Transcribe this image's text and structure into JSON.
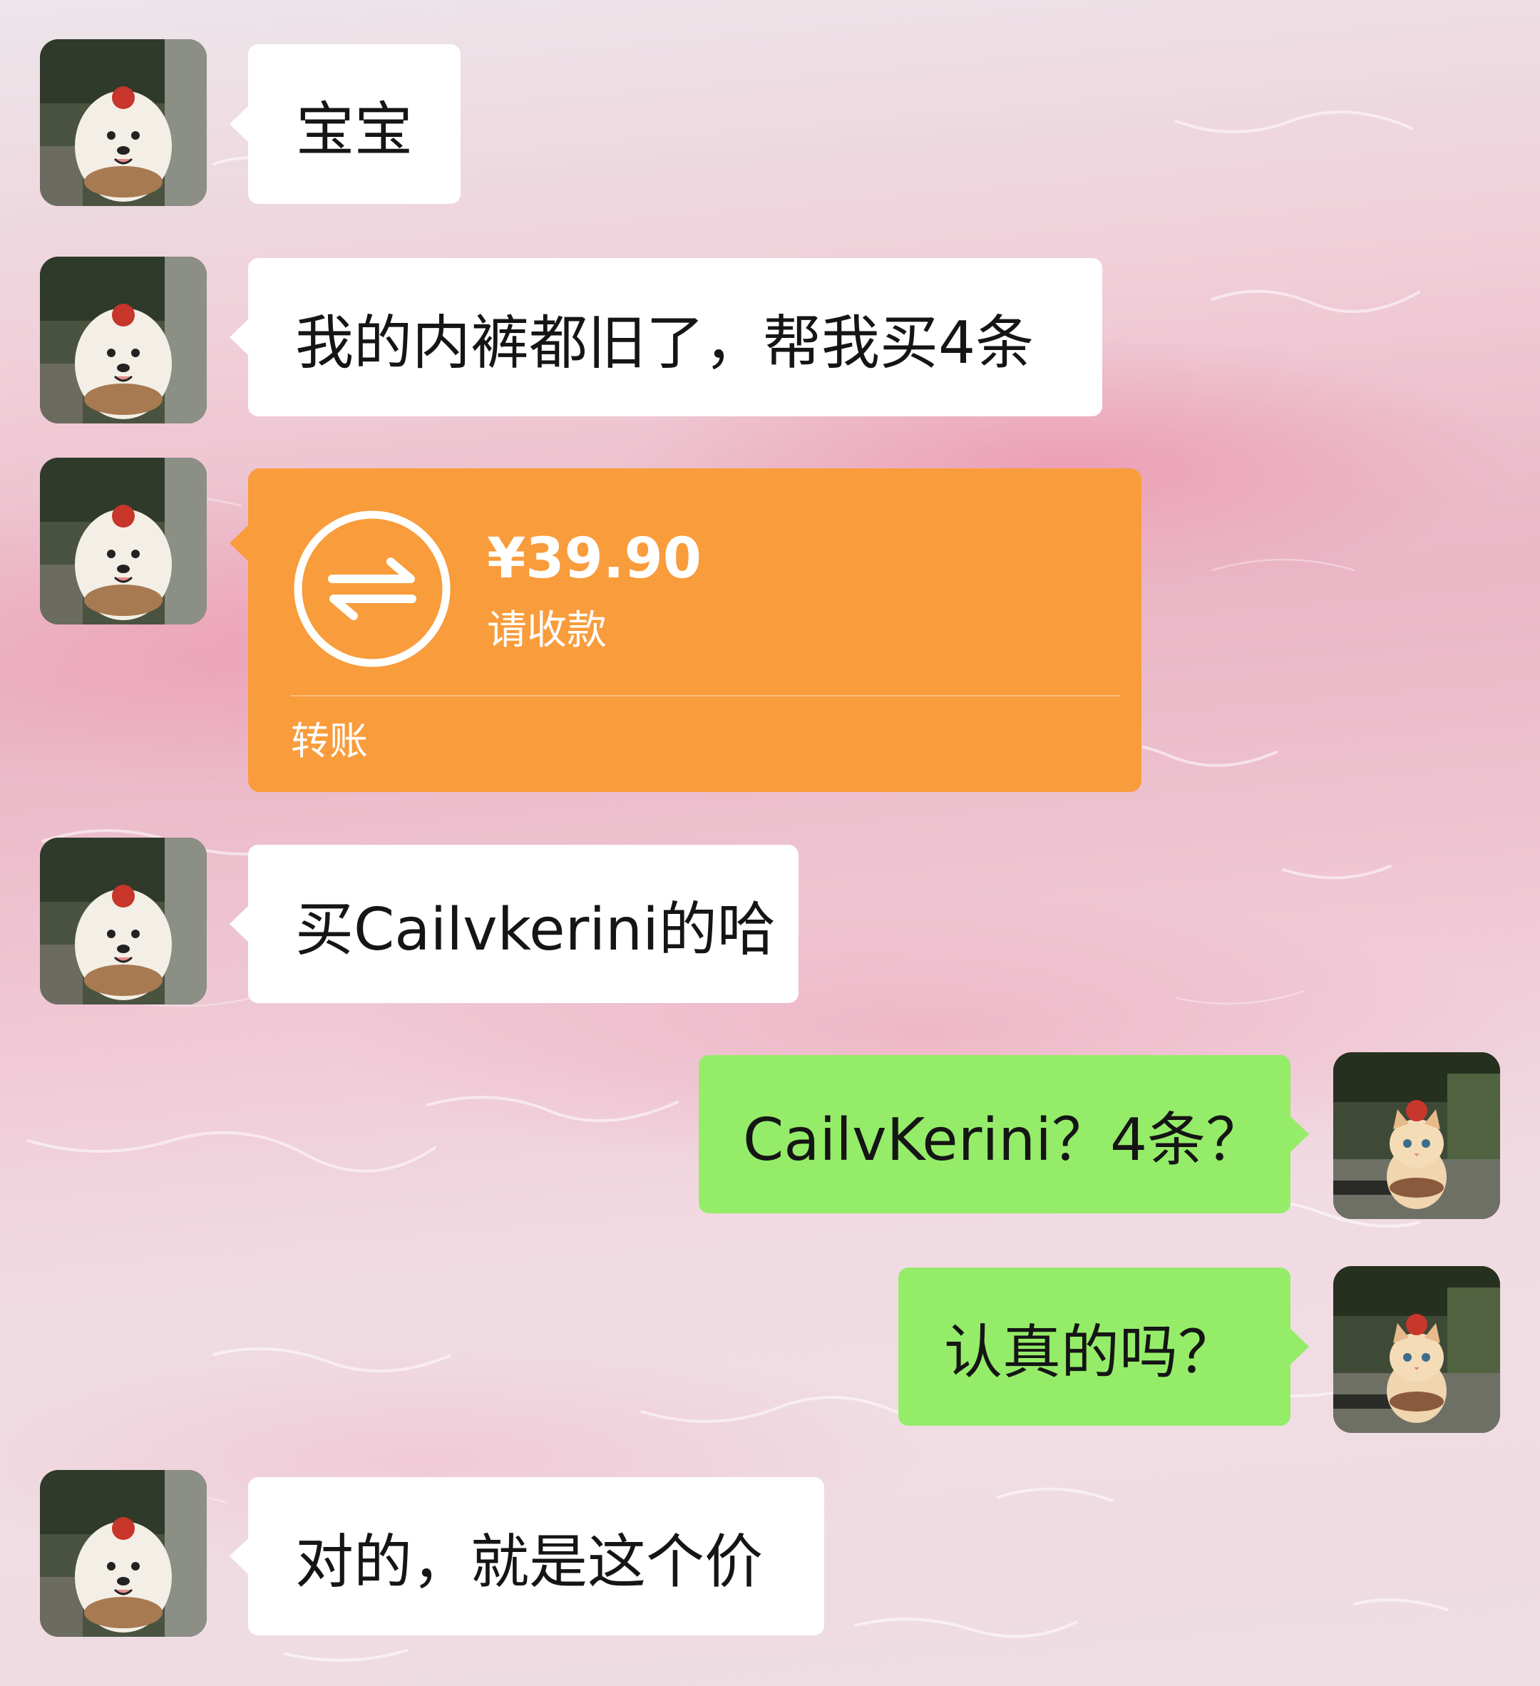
{
  "messages": [
    {
      "side": "left",
      "text": "宝宝"
    },
    {
      "side": "left",
      "text": "我的内裤都旧了，帮我买4条"
    },
    {
      "side": "left",
      "type": "transfer",
      "amount": "¥39.90",
      "status": "请收款",
      "label": "转账"
    },
    {
      "side": "left",
      "text": "买Cailvkerini的哈"
    },
    {
      "side": "right",
      "text": "CailvKerini？4条？"
    },
    {
      "side": "right",
      "text": "认真的吗？"
    },
    {
      "side": "left",
      "text": "对的，就是这个价"
    }
  ],
  "colors": {
    "incoming_bubble": "#ffffff",
    "outgoing_bubble": "#95ec69",
    "transfer_card": "#f99c3b"
  },
  "avatars": {
    "incoming": "dog-avatar",
    "outgoing": "cat-avatar"
  },
  "icons": {
    "transfer": "transfer-arrows-icon"
  }
}
